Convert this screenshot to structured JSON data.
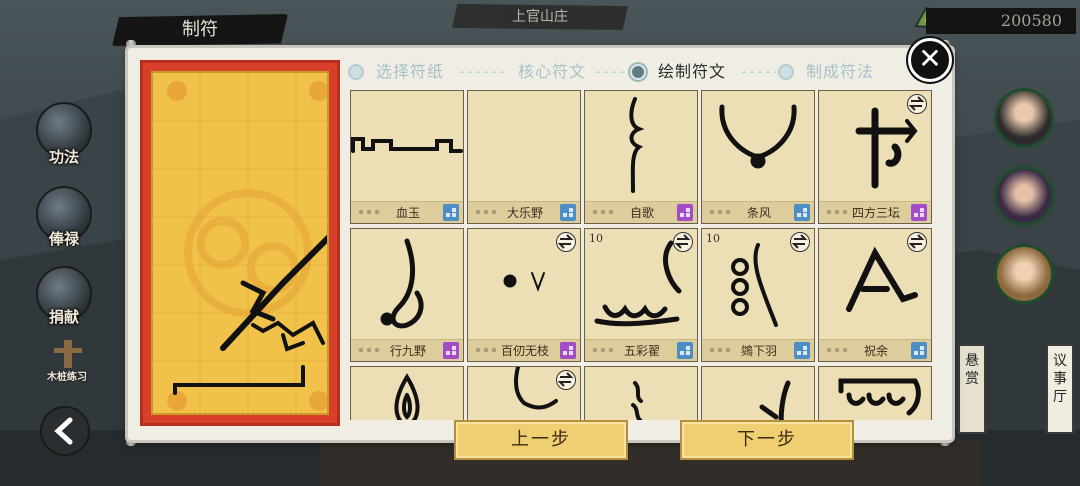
{
  "header": {
    "title": "制符",
    "location": "上官山庄",
    "currency_amount": "200580"
  },
  "side_menu": [
    {
      "label": "功法"
    },
    {
      "label": "俸禄"
    },
    {
      "label": "捐献"
    }
  ],
  "practice_label": "木桩练习",
  "steps": [
    {
      "label": "选择符纸",
      "state": "done"
    },
    {
      "label": "核心符文",
      "state": "done"
    },
    {
      "label": "绘制符文",
      "state": "active"
    },
    {
      "label": "制成符法",
      "state": "pending"
    }
  ],
  "runes": [
    {
      "name": "血玉",
      "count": "",
      "swap": false,
      "badge": "blue",
      "glyph": "wall"
    },
    {
      "name": "大乐野",
      "count": "",
      "swap": false,
      "badge": "blue",
      "glyph": "empty"
    },
    {
      "name": "自歌",
      "count": "",
      "swap": false,
      "badge": "purple",
      "glyph": "hook"
    },
    {
      "name": "条风",
      "count": "",
      "swap": false,
      "badge": "blue",
      "glyph": "horns"
    },
    {
      "name": "四方三坛",
      "count": "",
      "swap": true,
      "badge": "purple",
      "glyph": "cross"
    },
    {
      "name": "行九野",
      "count": "",
      "swap": false,
      "badge": "purple",
      "glyph": "foot"
    },
    {
      "name": "百仞无枝",
      "count": "",
      "swap": true,
      "badge": "purple",
      "glyph": "dot"
    },
    {
      "name": "五彩翟",
      "count": "10",
      "swap": true,
      "badge": "blue",
      "glyph": "waves"
    },
    {
      "name": "鵕下羽",
      "count": "10",
      "swap": true,
      "badge": "blue",
      "glyph": "loops"
    },
    {
      "name": "祝余",
      "count": "",
      "swap": true,
      "badge": "blue",
      "glyph": "peak"
    },
    {
      "name": "",
      "count": "",
      "swap": false,
      "badge": "",
      "glyph": "flame"
    },
    {
      "name": "",
      "count": "",
      "swap": true,
      "badge": "",
      "glyph": "stem"
    },
    {
      "name": "",
      "count": "",
      "swap": false,
      "badge": "",
      "glyph": "drip"
    },
    {
      "name": "",
      "count": "",
      "swap": false,
      "badge": "",
      "glyph": "slash"
    },
    {
      "name": "",
      "count": "",
      "swap": false,
      "badge": "",
      "glyph": "arch"
    }
  ],
  "buttons": {
    "prev": "上一步",
    "next": "下一步"
  },
  "boards": {
    "reward": "悬赏",
    "council": "议事厅"
  },
  "colors": {
    "talisman_border": "#d9402a",
    "talisman_paper": "#f0c24a",
    "card_bg": "#eddfb5",
    "badge_blue": "#4d8fc5",
    "badge_purple": "#a24cc7",
    "button_gold": "#f0cf73"
  }
}
